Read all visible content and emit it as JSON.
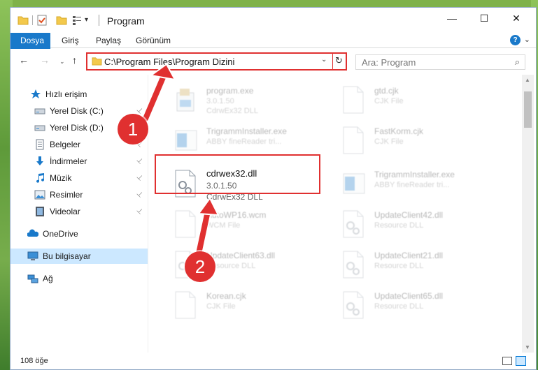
{
  "window": {
    "title": "Program",
    "minimize_glyph": "—",
    "maximize_glyph": "☐",
    "close_glyph": "✕"
  },
  "ribbon": {
    "tabs": [
      "Dosya",
      "Giriş",
      "Paylaş",
      "Görünüm"
    ],
    "expand_glyph": "⌄",
    "help_glyph": "?"
  },
  "nav": {
    "back_glyph": "←",
    "forward_glyph": "→",
    "recent_glyph": "⌄",
    "up_glyph": "↑",
    "address": "C:\\Program Files\\Program Dizini",
    "address_dropdown_glyph": "⌄",
    "refresh_glyph": "↻",
    "search_placeholder": "Ara: Program",
    "search_glyph": "⌕"
  },
  "navpane": {
    "items": [
      {
        "label": "Hızlı erişim",
        "icon": "star-icon",
        "pinned": false
      },
      {
        "label": "Yerel Disk (C:)",
        "icon": "drive-icon",
        "pinned": true
      },
      {
        "label": "Yerel Disk (D:)",
        "icon": "drive-icon",
        "pinned": true
      },
      {
        "label": "Belgeler",
        "icon": "documents-icon",
        "pinned": true
      },
      {
        "label": "İndirmeler",
        "icon": "download-icon",
        "pinned": true
      },
      {
        "label": "Müzik",
        "icon": "music-icon",
        "pinned": true
      },
      {
        "label": "Resimler",
        "icon": "pictures-icon",
        "pinned": true
      },
      {
        "label": "Videolar",
        "icon": "videos-icon",
        "pinned": true
      },
      {
        "label": "OneDrive",
        "icon": "onedrive-icon",
        "pinned": false
      },
      {
        "label": "Bu bilgisayar",
        "icon": "computer-icon",
        "pinned": false,
        "selected": true
      },
      {
        "label": "Ağ",
        "icon": "network-icon",
        "pinned": false
      }
    ],
    "pin_glyph": "📌"
  },
  "files": [
    {
      "name": "program.exe",
      "line1": "3.0.1.50",
      "line2": "CdrwEx32 DLL",
      "icon": "exe-icon",
      "faded": true
    },
    {
      "name": "gtd.cjk",
      "line1": "CJK File",
      "line2": "",
      "icon": "file-icon",
      "faded": true
    },
    {
      "name": "TrigrammInstaller.exe",
      "line1": "ABBY fineReader tri...",
      "line2": "",
      "icon": "installer-icon",
      "faded": true
    },
    {
      "name": "FastKorm.cjk",
      "line1": "CJK File",
      "line2": "",
      "icon": "file-icon",
      "faded": true
    },
    {
      "name": "cdrwex32.dll",
      "line1": "3.0.1.50",
      "line2": "CdrwEx32 DLL",
      "icon": "dll-icon",
      "faded": false
    },
    {
      "name": "TrigrammInstaller.exe",
      "line1": "ABBY fineReader tri...",
      "line2": "",
      "icon": "installer-icon",
      "faded": true
    },
    {
      "name": "AutoWP16.wcm",
      "line1": "WCM File",
      "line2": "",
      "icon": "file-icon",
      "faded": true
    },
    {
      "name": "UpdateClient42.dll",
      "line1": "Resource DLL",
      "line2": "",
      "icon": "dll-icon",
      "faded": true
    },
    {
      "name": "UpdateClient63.dll",
      "line1": "Resource DLL",
      "line2": "",
      "icon": "dll-icon",
      "faded": true
    },
    {
      "name": "UpdateClient21.dll",
      "line1": "Resource DLL",
      "line2": "",
      "icon": "dll-icon",
      "faded": true
    },
    {
      "name": "Korean.cjk",
      "line1": "CJK File",
      "line2": "",
      "icon": "file-icon",
      "faded": true
    },
    {
      "name": "UpdateClient65.dll",
      "line1": "Resource DLL",
      "line2": "",
      "icon": "dll-icon",
      "faded": true
    }
  ],
  "status": {
    "count": "108 öğe"
  },
  "callouts": [
    "1",
    "2"
  ],
  "colors": {
    "accent": "#1979ca",
    "highlight": "#e03030",
    "selection": "#cce8ff"
  }
}
